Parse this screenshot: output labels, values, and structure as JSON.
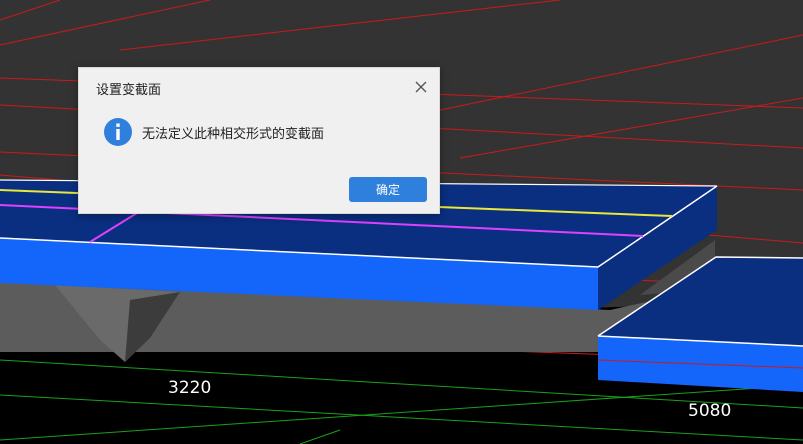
{
  "viewport": {
    "dimension_labels": [
      "3220",
      "5080"
    ]
  },
  "dialog": {
    "title": "设置变截面",
    "message": "无法定义此种相交形式的变截面",
    "ok_label": "确定",
    "icon": "info-icon",
    "close_icon": "close-icon",
    "accent_color": "#2f80dc"
  }
}
